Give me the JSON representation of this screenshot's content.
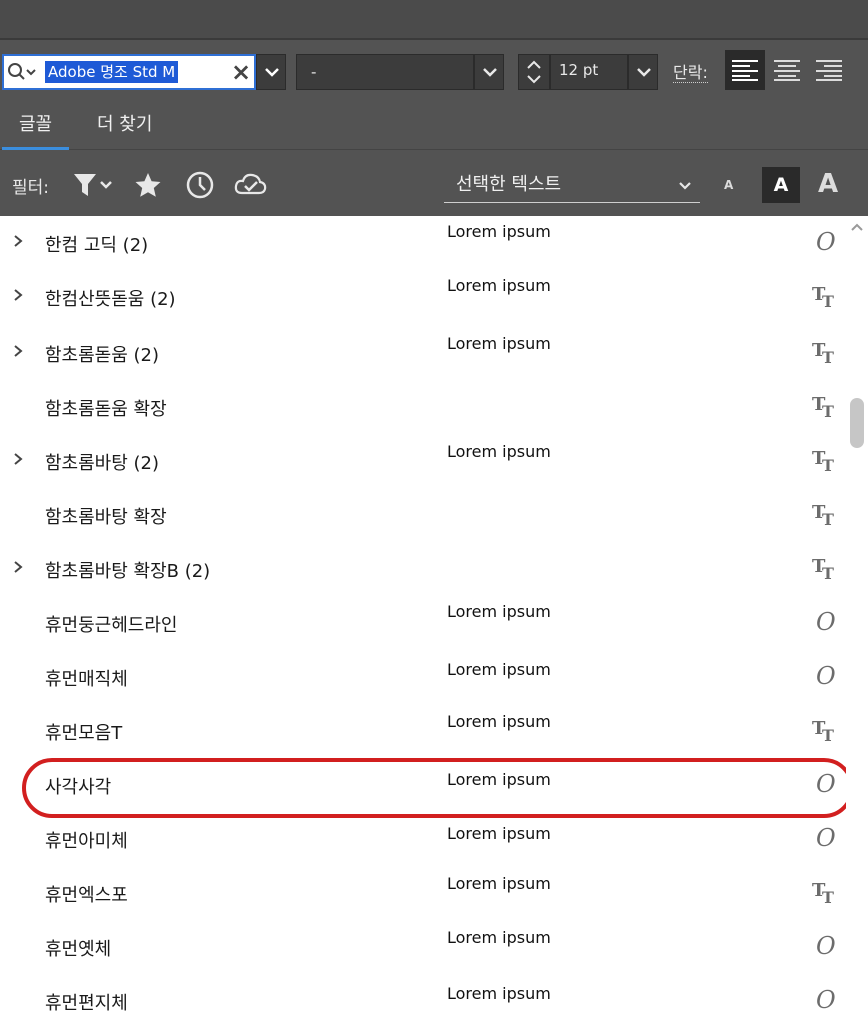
{
  "toolbar": {
    "font_search_value": "Adobe 명조 Std M",
    "style_value": "-",
    "size_value": "12 pt",
    "paragraph_label": "단락:"
  },
  "tabs": [
    {
      "label": "글꼴",
      "active": true
    },
    {
      "label": "더 찾기",
      "active": false
    }
  ],
  "filters": {
    "label": "필터:",
    "preview_mode": "선택한 텍스트",
    "preview_sizes": [
      "A",
      "A",
      "A"
    ]
  },
  "font_list": [
    {
      "name": "한컴 고딕 (2)",
      "expandable": true,
      "preview": "Lorem ipsum",
      "type": "opentype"
    },
    {
      "name": "한컴산뜻돋움 (2)",
      "expandable": true,
      "preview": "Lorem ipsum",
      "type": "truetype"
    },
    {
      "name": "함초롬돋움 (2)",
      "expandable": true,
      "preview": "Lorem ipsum",
      "type": "truetype"
    },
    {
      "name": "함초롬돋움 확장",
      "expandable": false,
      "preview": "",
      "type": "truetype"
    },
    {
      "name": "함초롬바탕 (2)",
      "expandable": true,
      "preview": "Lorem ipsum",
      "type": "truetype"
    },
    {
      "name": "함초롬바탕 확장",
      "expandable": false,
      "preview": "",
      "type": "truetype"
    },
    {
      "name": "함초롬바탕 확장B (2)",
      "expandable": true,
      "preview": "",
      "type": "truetype"
    },
    {
      "name": "휴먼둥근헤드라인",
      "expandable": false,
      "preview": "Lorem ipsum",
      "type": "opentype"
    },
    {
      "name": "휴먼매직체",
      "expandable": false,
      "preview": "Lorem ipsum",
      "type": "opentype"
    },
    {
      "name": "휴먼모음T",
      "expandable": false,
      "preview": "Lorem ipsum",
      "type": "truetype"
    },
    {
      "name": "사각사각",
      "expandable": false,
      "preview": "Lorem ipsum",
      "type": "opentype",
      "highlighted": true
    },
    {
      "name": "휴먼아미체",
      "expandable": false,
      "preview": "Lorem ipsum",
      "type": "opentype"
    },
    {
      "name": "휴먼엑스포",
      "expandable": false,
      "preview": "Lorem ipsum",
      "type": "truetype"
    },
    {
      "name": "휴먼옛체",
      "expandable": false,
      "preview": "Lorem ipsum",
      "type": "opentype"
    },
    {
      "name": "휴먼편지체",
      "expandable": false,
      "preview": "Lorem ipsum",
      "type": "opentype"
    }
  ],
  "colors": {
    "panel_bg": "#535353",
    "list_bg": "#ffffff",
    "selection": "#1e5ad6",
    "tab_underline": "#3b8ede",
    "highlight_ring": "#d21f1f"
  }
}
